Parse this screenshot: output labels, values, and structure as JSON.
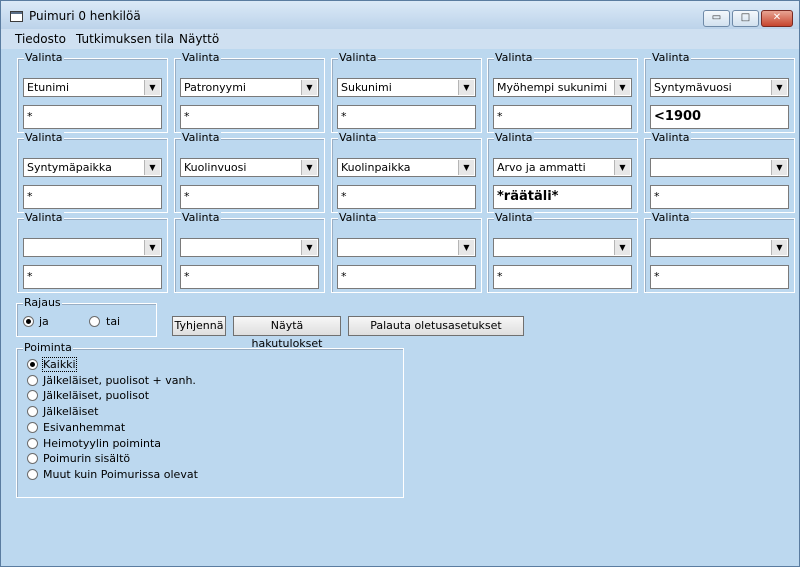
{
  "window": {
    "title": "Puimuri 0 henkilöä",
    "min_glyph": "▭",
    "max_glyph": "□",
    "close_glyph": "✕"
  },
  "menu": {
    "items": [
      "Tiedosto",
      "Tutkimuksen tila",
      "Näyttö"
    ]
  },
  "criteria": {
    "legend": "Valinta",
    "rows": [
      [
        {
          "field": "Etunimi",
          "value": "*"
        },
        {
          "field": "Patronyymi",
          "value": "*"
        },
        {
          "field": "Sukunimi",
          "value": "*"
        },
        {
          "field": "Myöhempi sukunimi",
          "value": "*"
        },
        {
          "field": "Syntymävuosi",
          "value": "<1900"
        }
      ],
      [
        {
          "field": "Syntymäpaikka",
          "value": "*"
        },
        {
          "field": "Kuolinvuosi",
          "value": "*"
        },
        {
          "field": "Kuolinpaikka",
          "value": "*"
        },
        {
          "field": "Arvo ja ammatti",
          "value": "*räätäli*"
        },
        {
          "field": "",
          "value": "*"
        }
      ],
      [
        {
          "field": "",
          "value": "*"
        },
        {
          "field": "",
          "value": "*"
        },
        {
          "field": "",
          "value": "*"
        },
        {
          "field": "",
          "value": "*"
        },
        {
          "field": "",
          "value": "*"
        }
      ]
    ]
  },
  "rajaus": {
    "legend": "Rajaus",
    "options": [
      "ja",
      "tai"
    ],
    "selected": "ja"
  },
  "buttons": {
    "clear": "Tyhjennä",
    "show_results": "Näytä hakutulokset",
    "restore_defaults": "Palauta oletusasetukset"
  },
  "poiminta": {
    "legend": "Poiminta",
    "options": [
      "Kaikki",
      "Jälkeläiset, puolisot + vanh.",
      "Jälkeläiset, puolisot",
      "Jälkeläiset",
      "Esivanhemmat",
      "Heimotyylin poiminta",
      "Poimurin sisältö",
      "Muut kuin Poimurissa olevat"
    ],
    "selected": "Kaikki"
  },
  "colors": {
    "window_bg": "#bcd8ef",
    "close_red": "#c7452e"
  }
}
